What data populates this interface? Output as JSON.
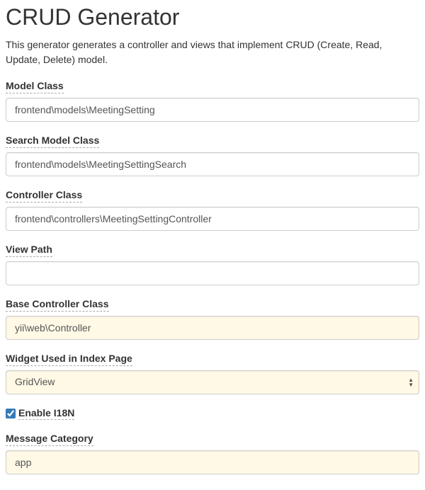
{
  "header": {
    "title": "CRUD Generator",
    "description": "This generator generates a controller and views that implement CRUD (Create, Read, Update, Delete) model."
  },
  "form": {
    "modelClass": {
      "label": "Model Class",
      "value": "frontend\\models\\MeetingSetting"
    },
    "searchModelClass": {
      "label": "Search Model Class",
      "value": "frontend\\models\\MeetingSettingSearch"
    },
    "controllerClass": {
      "label": "Controller Class",
      "value": "frontend\\controllers\\MeetingSettingController"
    },
    "viewPath": {
      "label": "View Path",
      "value": ""
    },
    "baseControllerClass": {
      "label": "Base Controller Class",
      "value": "yii\\web\\Controller"
    },
    "widgetUsed": {
      "label": "Widget Used in Index Page",
      "selected": "GridView"
    },
    "enableI18N": {
      "label": "Enable I18N",
      "checked": true
    },
    "messageCategory": {
      "label": "Message Category",
      "value": "app"
    }
  }
}
